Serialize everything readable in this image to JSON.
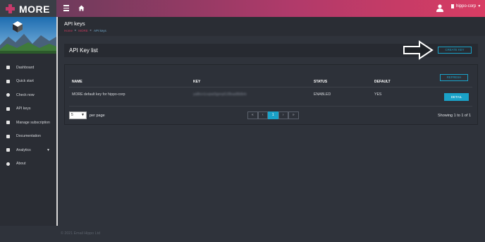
{
  "brand": {
    "name": "MORE"
  },
  "topbar": {
    "user_label": "hippo-corp"
  },
  "sidebar": {
    "items": [
      {
        "label": "Dashboard",
        "icon": "dashboard-icon"
      },
      {
        "label": "Quick start",
        "icon": "quickstart-icon"
      },
      {
        "label": "Check now",
        "icon": "check-icon"
      },
      {
        "label": "API keys",
        "icon": "key-icon"
      },
      {
        "label": "Manage subscription",
        "icon": "subscription-icon"
      },
      {
        "label": "Documentation",
        "icon": "document-icon"
      },
      {
        "label": "Analytics",
        "icon": "analytics-icon"
      },
      {
        "label": "About",
        "icon": "info-icon"
      }
    ]
  },
  "page": {
    "title": "API keys",
    "breadcrumb": [
      "Home",
      "MORE",
      "API keys"
    ]
  },
  "api_key_list": {
    "title": "API Key list",
    "create_button": "CREATE KEY",
    "refresh_button": "REFRESH",
    "columns": [
      "NAME",
      "KEY",
      "STATUS",
      "DEFAULT"
    ],
    "rows": [
      {
        "name": "MORE default key for hippo-corp",
        "key": "ya8tcn1cvpwl3genp51f8sad8b8eb",
        "status": "ENABLED",
        "default": "YES",
        "action": "DETAIL"
      }
    ]
  },
  "pagination": {
    "per_page_value": "5",
    "per_page_label": "per page",
    "buttons": [
      "«",
      "‹",
      "1",
      "›",
      "»"
    ],
    "showing": "Showing 1 to 1 of 1"
  },
  "footer": {
    "text": "© 2021 Email Hippo Ltd"
  },
  "colors": {
    "accent": "#1aa2c8",
    "brand": "#c43a6b",
    "topbar_end": "#d83c63"
  }
}
